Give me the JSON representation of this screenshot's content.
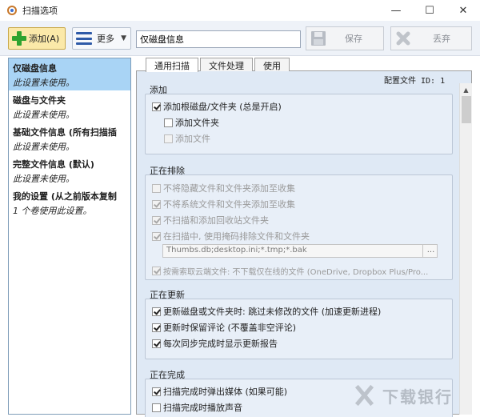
{
  "window": {
    "title": "扫描选项",
    "minimize": "—",
    "maximize": "☐",
    "close": "✕"
  },
  "toolbar": {
    "add_label": "添加(A)",
    "more_label": "更多",
    "name_value": "仅磁盘信息",
    "save_label": "保存",
    "discard_label": "丢弃"
  },
  "sidebar": {
    "items": [
      {
        "name": "仅磁盘信息",
        "status": "此设置未使用。",
        "selected": true
      },
      {
        "name": "磁盘与文件夹",
        "status": "此设置未使用。"
      },
      {
        "name": "基础文件信息 (所有扫描插",
        "status": "此设置未使用。"
      },
      {
        "name": "完整文件信息 (默认)",
        "status": "此设置未使用。"
      },
      {
        "name": "我的设置 (从之前版本复制",
        "status": "1 个卷使用此设置。"
      }
    ]
  },
  "tabs": [
    "通用扫描",
    "文件处理",
    "使用"
  ],
  "config_id": "配置文件 ID: 1",
  "groups": {
    "add": {
      "title": "添加",
      "items": [
        {
          "label": "添加根磁盘/文件夹 (总是开启)",
          "checked": true,
          "disabled": false
        },
        {
          "label": "添加文件夹",
          "checked": false,
          "disabled": false
        },
        {
          "label": "添加文件",
          "checked": false,
          "disabled": true
        }
      ]
    },
    "exclude": {
      "title": "正在排除",
      "items": [
        {
          "label": "不将隐藏文件和文件夹添加至收集",
          "checked": false,
          "disabled": true
        },
        {
          "label": "不将系统文件和文件夹添加至收集",
          "checked": true,
          "disabled": true
        },
        {
          "label": "不扫描和添加回收站文件夹",
          "checked": true,
          "disabled": true
        },
        {
          "label": "在扫描中, 使用掩码排除文件和文件夹",
          "checked": true,
          "disabled": true
        },
        {
          "label": "按需索取云端文件: 不下载仅在线的文件 (OneDrive, Dropbox Plus/Pro...",
          "checked": true,
          "disabled": true
        }
      ],
      "mask_value": "Thumbs.db;desktop.ini;*.tmp;*.bak",
      "mask_button": "..."
    },
    "update": {
      "title": "正在更新",
      "items": [
        {
          "label": "更新磁盘或文件夹时: 跳过未修改的文件 (加速更新进程)",
          "checked": true,
          "disabled": false
        },
        {
          "label": "更新时保留评论 (不覆盖非空评论)",
          "checked": true,
          "disabled": false
        },
        {
          "label": "每次同步完成时显示更新报告",
          "checked": true,
          "disabled": false
        }
      ]
    },
    "finish": {
      "title": "正在完成",
      "items": [
        {
          "label": "扫描完成时弹出媒体 (如果可能)",
          "checked": true,
          "disabled": false
        },
        {
          "label": "扫描完成时播放声音",
          "checked": false,
          "disabled": false
        }
      ]
    }
  },
  "watermark": "下载银行",
  "colors": {
    "selected_item": "#a9d4f5",
    "panel_bg": "#dfe9f5",
    "add_button": "#fbe9a9",
    "accent_icon": "#2e5aa8"
  },
  "icons": [
    "app-icon",
    "plus-icon",
    "menu-icon",
    "floppy-save-icon",
    "discard-x-icon"
  ]
}
